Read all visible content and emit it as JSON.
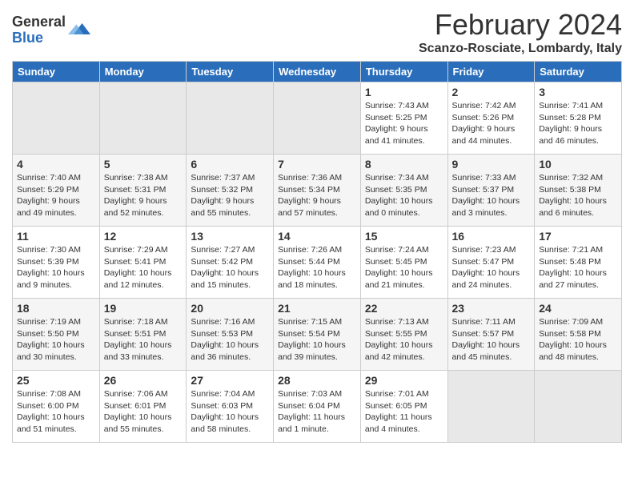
{
  "logo": {
    "general": "General",
    "blue": "Blue"
  },
  "title": "February 2024",
  "location": "Scanzo-Rosciate, Lombardy, Italy",
  "weekdays": [
    "Sunday",
    "Monday",
    "Tuesday",
    "Wednesday",
    "Thursday",
    "Friday",
    "Saturday"
  ],
  "weeks": [
    [
      {
        "day": "",
        "info": ""
      },
      {
        "day": "",
        "info": ""
      },
      {
        "day": "",
        "info": ""
      },
      {
        "day": "",
        "info": ""
      },
      {
        "day": "1",
        "info": "Sunrise: 7:43 AM\nSunset: 5:25 PM\nDaylight: 9 hours and 41 minutes."
      },
      {
        "day": "2",
        "info": "Sunrise: 7:42 AM\nSunset: 5:26 PM\nDaylight: 9 hours and 44 minutes."
      },
      {
        "day": "3",
        "info": "Sunrise: 7:41 AM\nSunset: 5:28 PM\nDaylight: 9 hours and 46 minutes."
      }
    ],
    [
      {
        "day": "4",
        "info": "Sunrise: 7:40 AM\nSunset: 5:29 PM\nDaylight: 9 hours and 49 minutes."
      },
      {
        "day": "5",
        "info": "Sunrise: 7:38 AM\nSunset: 5:31 PM\nDaylight: 9 hours and 52 minutes."
      },
      {
        "day": "6",
        "info": "Sunrise: 7:37 AM\nSunset: 5:32 PM\nDaylight: 9 hours and 55 minutes."
      },
      {
        "day": "7",
        "info": "Sunrise: 7:36 AM\nSunset: 5:34 PM\nDaylight: 9 hours and 57 minutes."
      },
      {
        "day": "8",
        "info": "Sunrise: 7:34 AM\nSunset: 5:35 PM\nDaylight: 10 hours and 0 minutes."
      },
      {
        "day": "9",
        "info": "Sunrise: 7:33 AM\nSunset: 5:37 PM\nDaylight: 10 hours and 3 minutes."
      },
      {
        "day": "10",
        "info": "Sunrise: 7:32 AM\nSunset: 5:38 PM\nDaylight: 10 hours and 6 minutes."
      }
    ],
    [
      {
        "day": "11",
        "info": "Sunrise: 7:30 AM\nSunset: 5:39 PM\nDaylight: 10 hours and 9 minutes."
      },
      {
        "day": "12",
        "info": "Sunrise: 7:29 AM\nSunset: 5:41 PM\nDaylight: 10 hours and 12 minutes."
      },
      {
        "day": "13",
        "info": "Sunrise: 7:27 AM\nSunset: 5:42 PM\nDaylight: 10 hours and 15 minutes."
      },
      {
        "day": "14",
        "info": "Sunrise: 7:26 AM\nSunset: 5:44 PM\nDaylight: 10 hours and 18 minutes."
      },
      {
        "day": "15",
        "info": "Sunrise: 7:24 AM\nSunset: 5:45 PM\nDaylight: 10 hours and 21 minutes."
      },
      {
        "day": "16",
        "info": "Sunrise: 7:23 AM\nSunset: 5:47 PM\nDaylight: 10 hours and 24 minutes."
      },
      {
        "day": "17",
        "info": "Sunrise: 7:21 AM\nSunset: 5:48 PM\nDaylight: 10 hours and 27 minutes."
      }
    ],
    [
      {
        "day": "18",
        "info": "Sunrise: 7:19 AM\nSunset: 5:50 PM\nDaylight: 10 hours and 30 minutes."
      },
      {
        "day": "19",
        "info": "Sunrise: 7:18 AM\nSunset: 5:51 PM\nDaylight: 10 hours and 33 minutes."
      },
      {
        "day": "20",
        "info": "Sunrise: 7:16 AM\nSunset: 5:53 PM\nDaylight: 10 hours and 36 minutes."
      },
      {
        "day": "21",
        "info": "Sunrise: 7:15 AM\nSunset: 5:54 PM\nDaylight: 10 hours and 39 minutes."
      },
      {
        "day": "22",
        "info": "Sunrise: 7:13 AM\nSunset: 5:55 PM\nDaylight: 10 hours and 42 minutes."
      },
      {
        "day": "23",
        "info": "Sunrise: 7:11 AM\nSunset: 5:57 PM\nDaylight: 10 hours and 45 minutes."
      },
      {
        "day": "24",
        "info": "Sunrise: 7:09 AM\nSunset: 5:58 PM\nDaylight: 10 hours and 48 minutes."
      }
    ],
    [
      {
        "day": "25",
        "info": "Sunrise: 7:08 AM\nSunset: 6:00 PM\nDaylight: 10 hours and 51 minutes."
      },
      {
        "day": "26",
        "info": "Sunrise: 7:06 AM\nSunset: 6:01 PM\nDaylight: 10 hours and 55 minutes."
      },
      {
        "day": "27",
        "info": "Sunrise: 7:04 AM\nSunset: 6:03 PM\nDaylight: 10 hours and 58 minutes."
      },
      {
        "day": "28",
        "info": "Sunrise: 7:03 AM\nSunset: 6:04 PM\nDaylight: 11 hours and 1 minute."
      },
      {
        "day": "29",
        "info": "Sunrise: 7:01 AM\nSunset: 6:05 PM\nDaylight: 11 hours and 4 minutes."
      },
      {
        "day": "",
        "info": ""
      },
      {
        "day": "",
        "info": ""
      }
    ]
  ]
}
